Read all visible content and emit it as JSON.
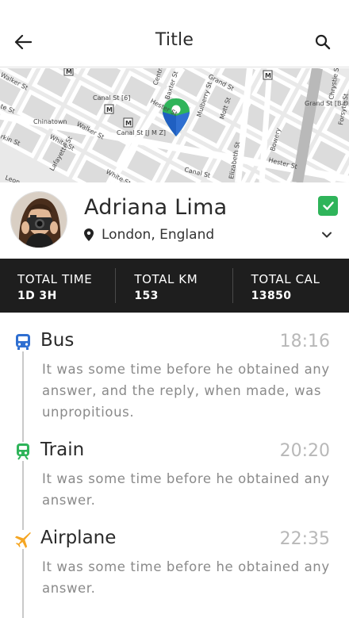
{
  "appbar": {
    "title": "Title"
  },
  "map": {
    "labels": [
      "Walker St",
      "Canal St [6]",
      "Grand St",
      "Baxter St",
      "Centre St",
      "Hester St",
      "Mulberry St",
      "Mott St",
      "Grand St [B D]",
      "Chinatown",
      "Walker St",
      "White St",
      "Canal St [J M Z]",
      "Lafayette St",
      "White St",
      "Canal St",
      "Elizabeth St",
      "Bowery",
      "Hester St",
      "Chrystie St",
      "Forsyth St",
      "te St",
      "rkin St",
      "Leon",
      "M"
    ],
    "water_color": "#ffffff"
  },
  "profile": {
    "name": "Adriana Lima",
    "location": "London, England",
    "verified_color": "#2fb45a"
  },
  "stats": [
    {
      "label": "TOTAL TIME",
      "value": "1D 3H"
    },
    {
      "label": "TOTAL KM",
      "value": "153"
    },
    {
      "label": "TOTAL CAL",
      "value": "13850"
    }
  ],
  "timeline": [
    {
      "title": "Bus",
      "time": "18:16",
      "description": "It was some time before he obtained any answer, and the reply, when made, was unpropitious.",
      "icon": "bus-icon",
      "color": "#2f6fd1"
    },
    {
      "title": "Train",
      "time": "20:20",
      "description": "It was some time before he obtained any answer.",
      "icon": "train-icon",
      "color": "#2fb45a"
    },
    {
      "title": "Airplane",
      "time": "22:35",
      "description": "It was some time before he obtained any answer.",
      "icon": "airplane-icon",
      "color": "#f5a623"
    }
  ]
}
